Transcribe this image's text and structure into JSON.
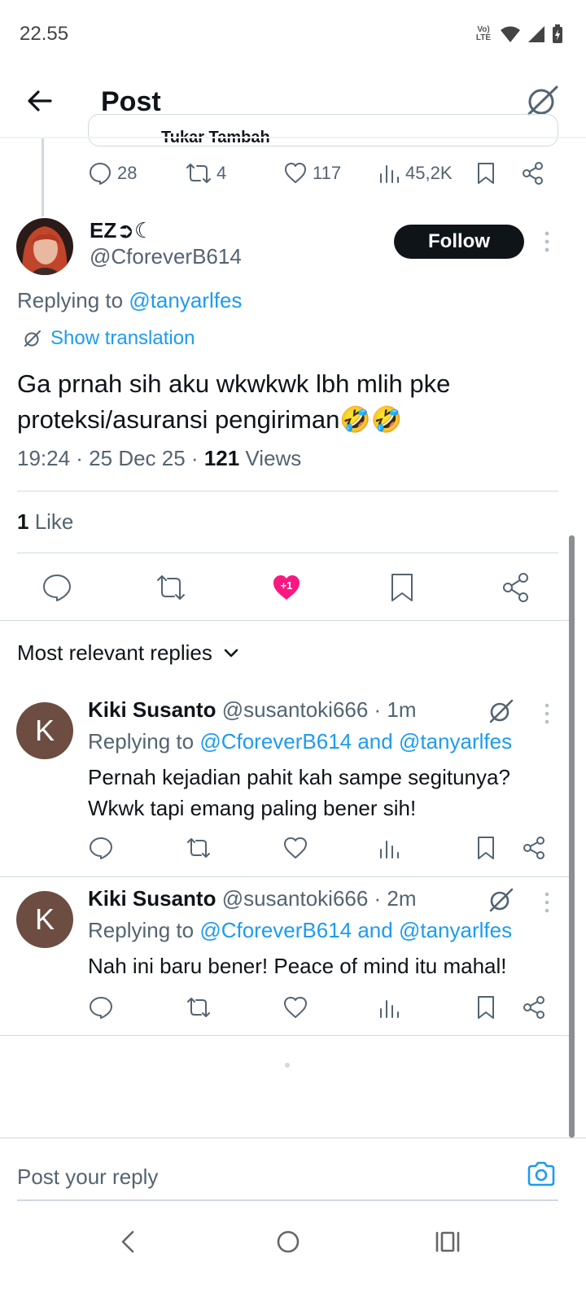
{
  "status_bar": {
    "time": "22.55",
    "network": "Vo) LTE"
  },
  "header": {
    "title": "Post"
  },
  "parent_post": {
    "quote_text": "Tukar Tambah",
    "replies": "28",
    "reposts": "4",
    "likes": "117",
    "views": "45,2K"
  },
  "main_post": {
    "display_name": "EZ➲☾",
    "handle": "@CforeverB614",
    "follow_label": "Follow",
    "replying_prefix": "Replying to",
    "replying_to": "@tanyarlfes",
    "translate_label": "Show translation",
    "text": "Ga prnah sih aku wkwkwk lbh mlih pke proteksi/asuransi pengiriman🤣🤣",
    "time": "19:24 · 25 Dec 25 · ",
    "views_count": "121",
    "views_label": " Views",
    "likes_count": "1",
    "likes_label": " Like",
    "like_badge": "+1"
  },
  "sort": {
    "label": "Most relevant replies"
  },
  "replies": [
    {
      "avatar_letter": "K",
      "name": "Kiki Susanto",
      "handle_time": " @susantoki666 · 1m",
      "replying_prefix": "Replying to ",
      "replying_to": "@CforeverB614 and @tanyarlfes",
      "text": "Pernah kejadian pahit kah sampe segitunya? Wkwk tapi emang paling bener sih!"
    },
    {
      "avatar_letter": "K",
      "name": "Kiki Susanto",
      "handle_time": " @susantoki666 · 2m",
      "replying_prefix": "Replying to ",
      "replying_to": "@CforeverB614 and @tanyarlfes",
      "text": "Nah ini baru bener! Peace of mind itu mahal!"
    }
  ],
  "composer": {
    "placeholder": "Post your reply"
  },
  "colors": {
    "accent": "#1d9bf0",
    "like_pink": "#f91880",
    "text": "#0f1419",
    "muted": "#536471"
  }
}
